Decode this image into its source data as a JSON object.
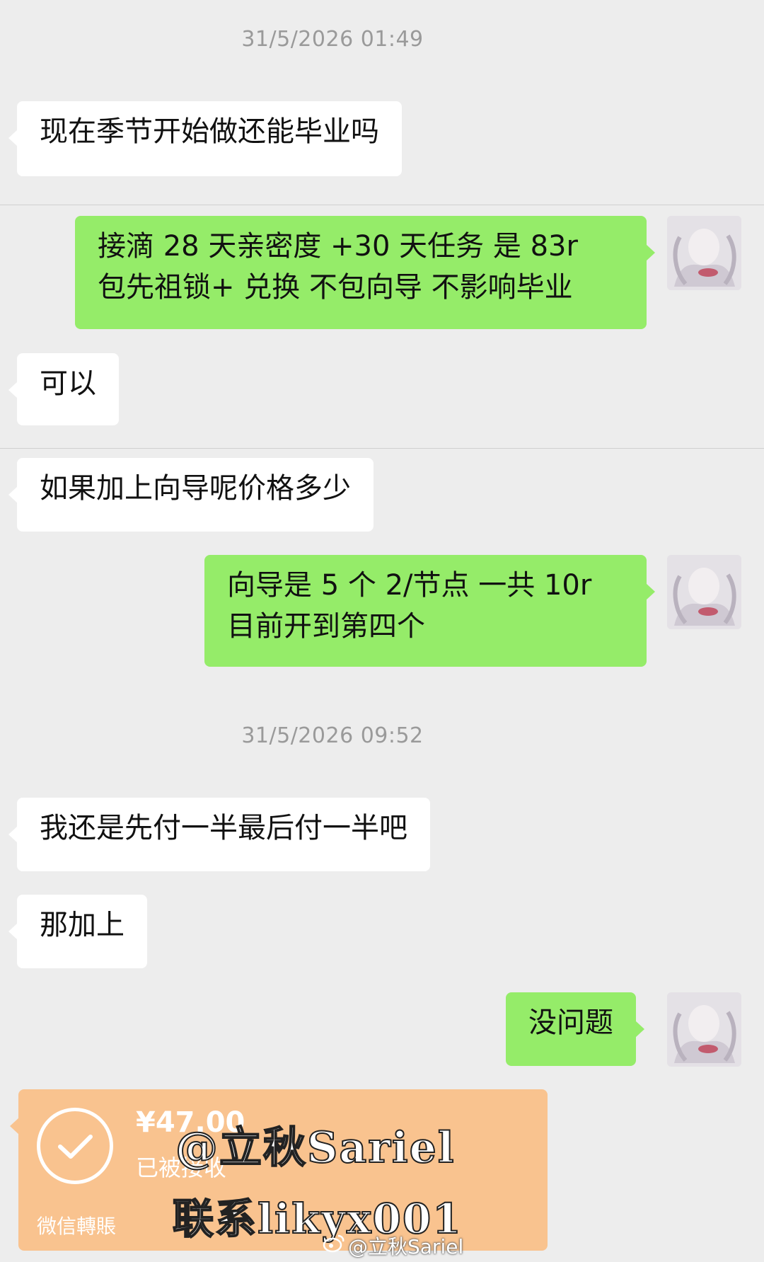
{
  "chat": {
    "timestamps": [
      "31/5/2026 01:49",
      "31/5/2026 09:52"
    ],
    "messages": [
      {
        "side": "left",
        "lines": [
          "现在季节开始做还能毕业吗"
        ]
      },
      {
        "side": "right",
        "lines": [
          "接滴 28 天亲密度 +30 天任务 是 83r",
          "包先祖锁+ 兑换 不包向导 不影响毕业"
        ]
      },
      {
        "side": "left",
        "lines": [
          "可以"
        ]
      },
      {
        "side": "left",
        "lines": [
          "如果加上向导呢价格多少"
        ]
      },
      {
        "side": "right",
        "lines": [
          "向导是 5 个 2/节点 一共 10r",
          "目前开到第四个"
        ]
      },
      {
        "side": "left",
        "lines": [
          "我还是先付一半最后付一半吧"
        ]
      },
      {
        "side": "left",
        "lines": [
          "那加上"
        ]
      },
      {
        "side": "right",
        "lines": [
          "没问题"
        ]
      }
    ],
    "transfer": {
      "amount": "¥47.00",
      "status": "已被接收",
      "label": "微信轉賬"
    }
  },
  "watermark": {
    "line1": "@立秋Sariel",
    "line2": "联系likyx001",
    "footer": "@立秋Sariel",
    "icon": "weibo-icon"
  },
  "colors": {
    "background": "#ededed",
    "left_bubble": "#ffffff",
    "right_bubble": "#95ec69",
    "transfer_card": "#f9c38f",
    "timestamp_text": "#9a9a9a"
  }
}
